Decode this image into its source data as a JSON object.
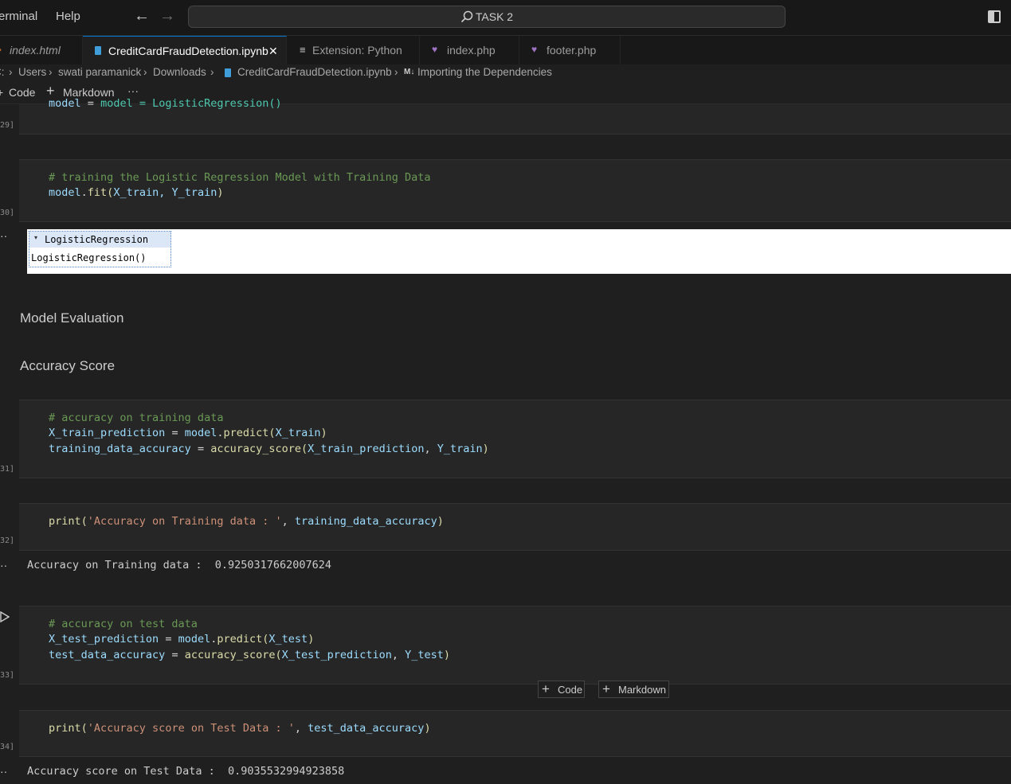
{
  "menu": {
    "terminal": "erminal",
    "help": "Help"
  },
  "nav": {
    "back": "←",
    "forward": "→"
  },
  "search": {
    "icon": "search-icon",
    "text": "TASK 2"
  },
  "tabs": [
    {
      "label": "index.html",
      "icon": "html-file-icon"
    },
    {
      "label": "CreditCardFraudDetection.ipynb",
      "icon": "notebook-icon",
      "close": "✕"
    },
    {
      "label": "Extension: Python",
      "icon": "extension-icon"
    },
    {
      "label": "index.php",
      "icon": "php-file-icon"
    },
    {
      "label": "footer.php",
      "icon": "php-file-icon"
    }
  ],
  "breadcrumb": {
    "root": "C:",
    "users": "Users",
    "user": "swati paramanick",
    "downloads": "Downloads",
    "file": "CreditCardFraudDetection.ipynb",
    "md_badge": "M↓",
    "section": "Importing the Dependencies"
  },
  "toolbar": {
    "code": "Code",
    "markdown": "Markdown",
    "more": "···"
  },
  "cells": {
    "c29": {
      "exec": "29]",
      "code_partial": "model = LogisticRegression()"
    },
    "c30": {
      "exec": "30]",
      "comment": "# training the Logistic Regression Model with Training Data",
      "line2_obj": "model",
      "line2_fn": "fit",
      "line2_args": "X_train, Y_train",
      "output_title": "LogisticRegression",
      "output_body": "LogisticRegression()"
    },
    "md1": "Model Evaluation",
    "md2": "Accuracy Score",
    "c31": {
      "exec": "31]",
      "comment": "# accuracy on training data",
      "l2_var": "X_train_prediction",
      "l2_obj": "model",
      "l2_fn": "predict",
      "l2_arg": "X_train",
      "l3_var": "training_data_accuracy",
      "l3_fn": "accuracy_score",
      "l3_arg1": "X_train_prediction",
      "l3_arg2": "Y_train"
    },
    "c32": {
      "exec": "32]",
      "fn": "print",
      "str": "'Accuracy on Training data : '",
      "arg": "training_data_accuracy",
      "output": "Accuracy on Training data :  0.9250317662007624"
    },
    "c33": {
      "exec": "33]",
      "comment": "# accuracy on test data",
      "l2_var": "X_test_prediction",
      "l2_obj": "model",
      "l2_fn": "predict",
      "l2_arg": "X_test",
      "l3_var": "test_data_accuracy",
      "l3_fn": "accuracy_score",
      "l3_arg1": "X_test_prediction",
      "l3_arg2": "Y_test"
    },
    "c34": {
      "exec": "34]",
      "fn": "print",
      "str": "'Accuracy score on Test Data : '",
      "arg": "test_data_accuracy",
      "output": "Accuracy score on Test Data :  0.9035532994923858"
    }
  },
  "insert": {
    "code": "Code",
    "markdown": "Markdown"
  },
  "colors": {
    "accent": "#0078d4",
    "comment": "#6a9955",
    "string": "#ce9178",
    "variable": "#9cdcfe",
    "function": "#dcdcaa"
  }
}
